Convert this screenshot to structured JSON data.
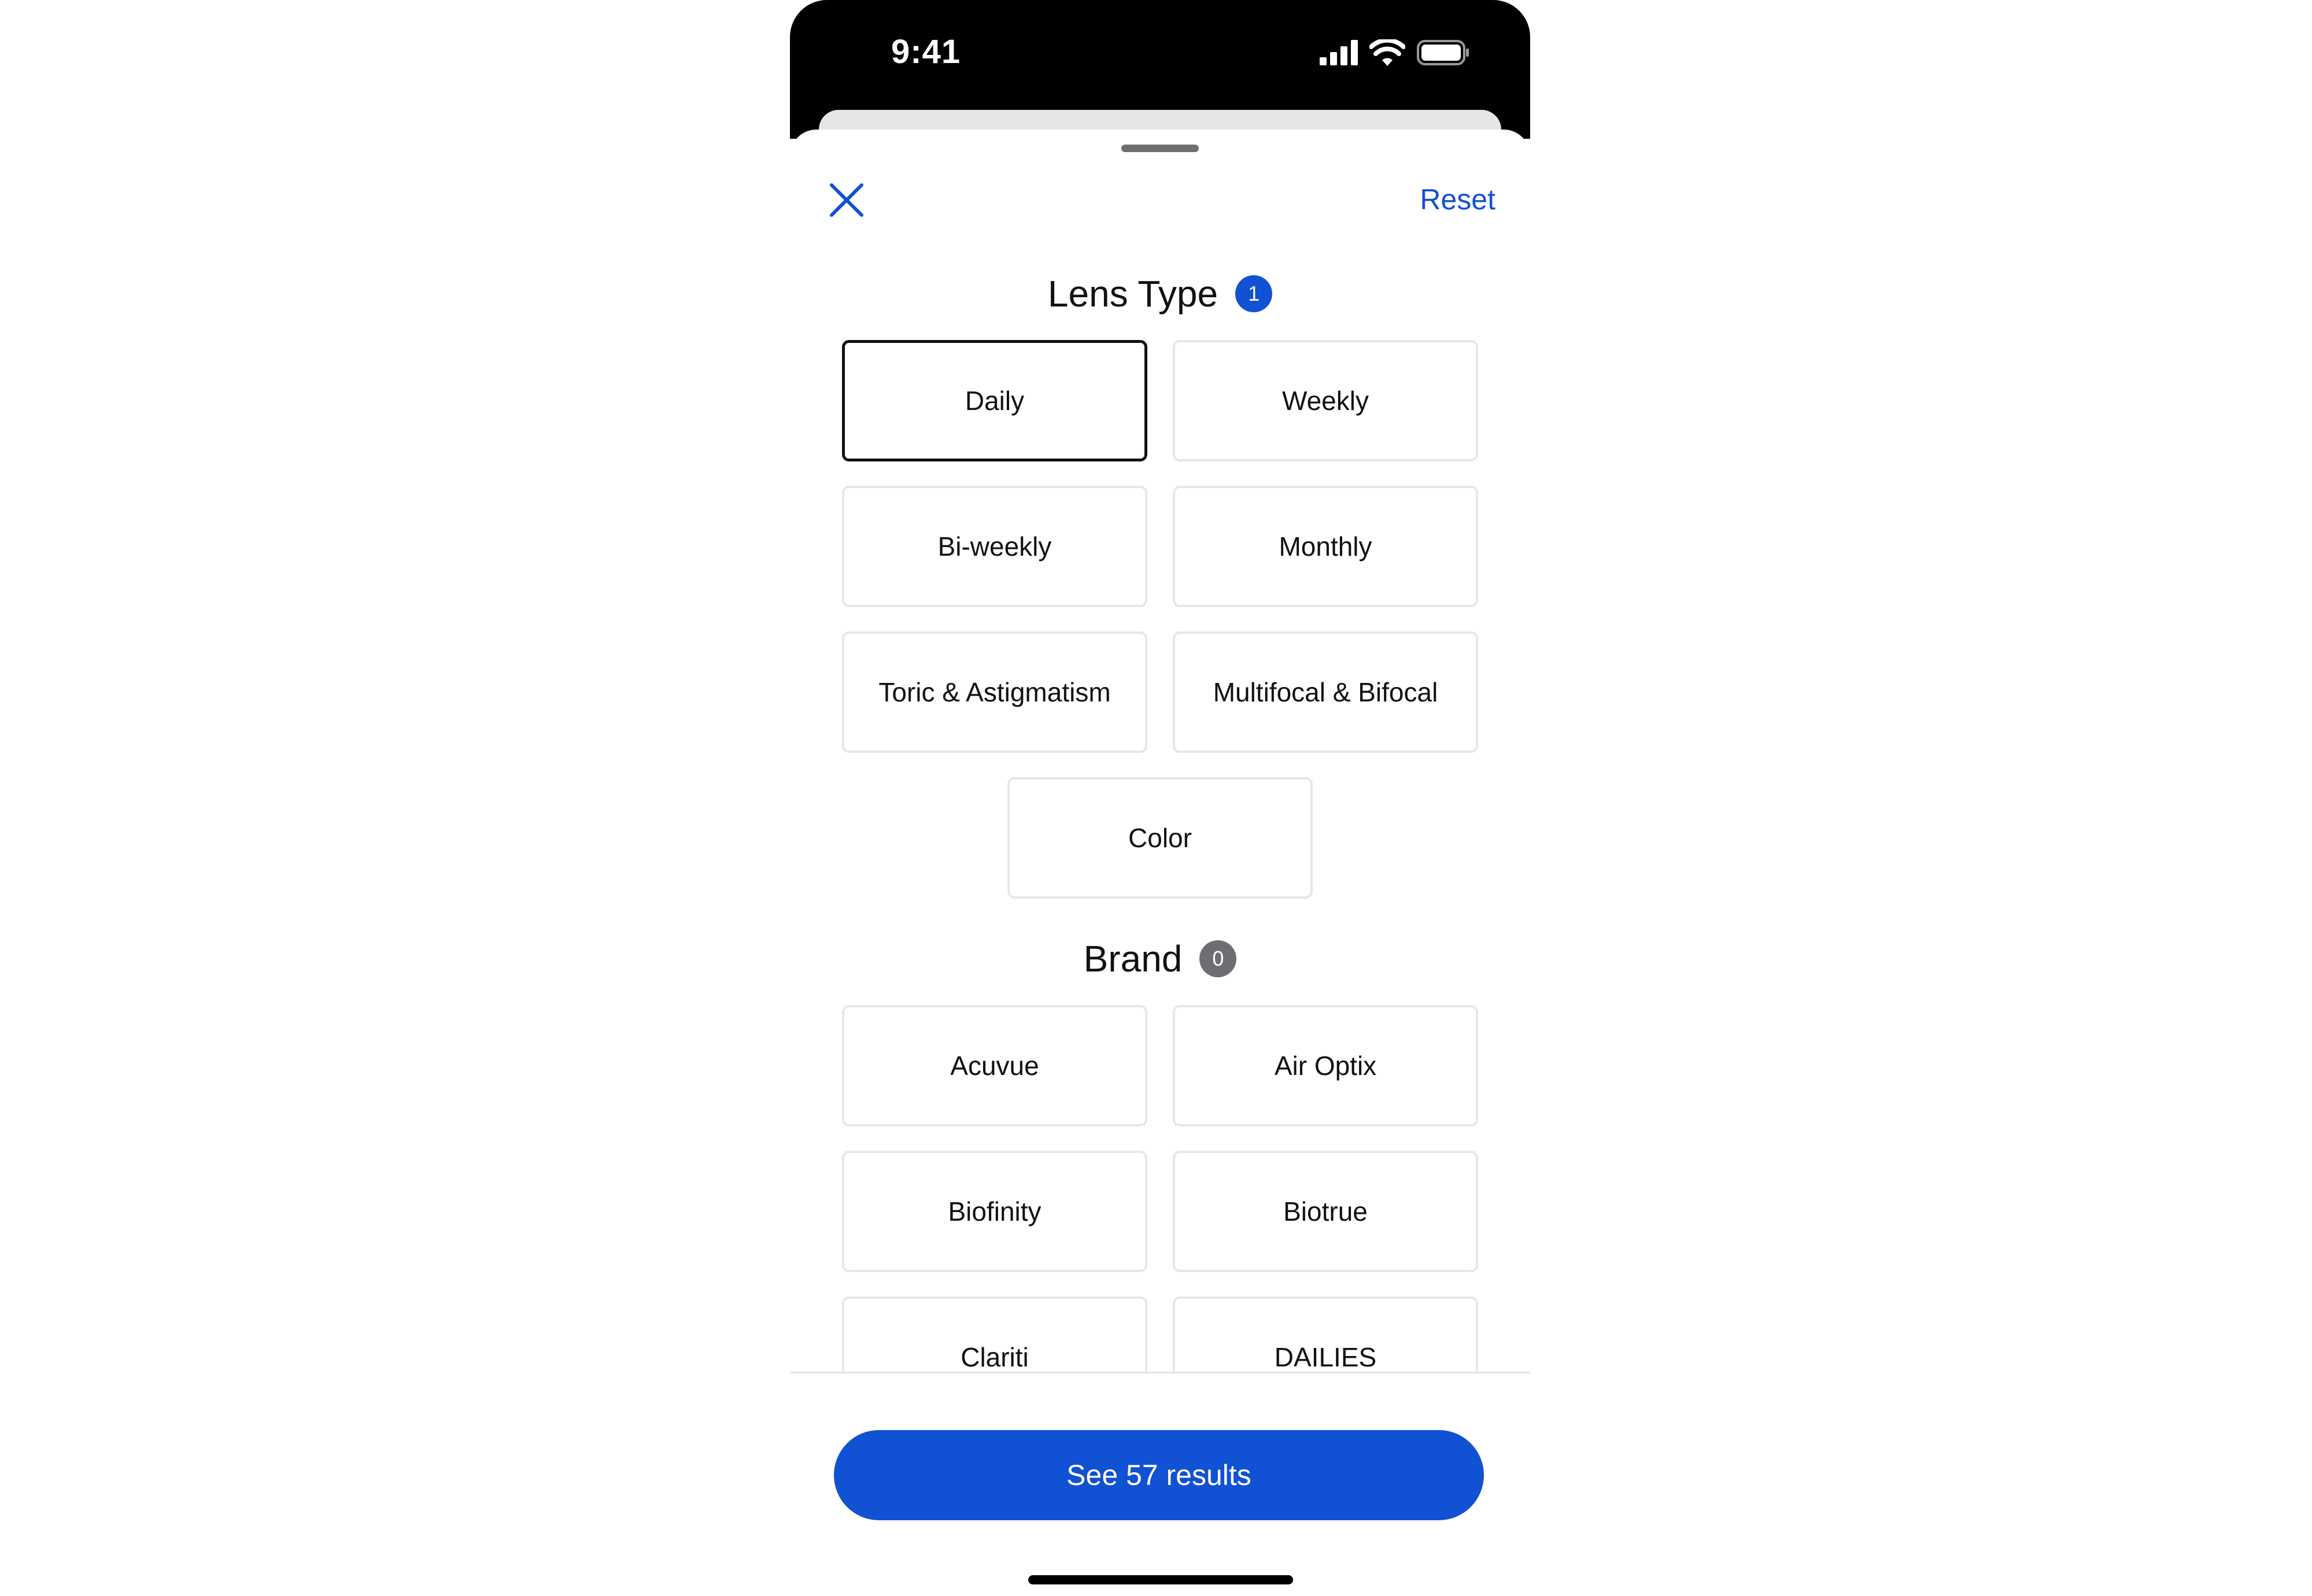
{
  "status_bar": {
    "time": "9:41"
  },
  "header": {
    "close_label": "Close",
    "reset_label": "Reset"
  },
  "lens_type": {
    "title": "Lens Type",
    "badge": "1",
    "options": [
      {
        "label": "Daily",
        "selected": true
      },
      {
        "label": "Weekly",
        "selected": false
      },
      {
        "label": "Bi-weekly",
        "selected": false
      },
      {
        "label": "Monthly",
        "selected": false
      },
      {
        "label": "Toric & Astigmatism",
        "selected": false
      },
      {
        "label": "Multifocal & Bifocal",
        "selected": false
      },
      {
        "label": "Color",
        "selected": false
      }
    ]
  },
  "brand": {
    "title": "Brand",
    "badge": "0",
    "options": [
      {
        "label": "Acuvue"
      },
      {
        "label": "Air Optix"
      },
      {
        "label": "Biofinity"
      },
      {
        "label": "Biotrue"
      },
      {
        "label": "Clariti"
      },
      {
        "label": "DAILIES"
      }
    ]
  },
  "footer": {
    "cta_label": "See 57 results"
  },
  "colors": {
    "accent": "#1151d3",
    "badge_gray": "#6d6e72",
    "border": "#e6e7ea",
    "selected_border": "#111111"
  },
  "icons": {
    "close": "close-icon",
    "signal": "cellular-signal-icon",
    "wifi": "wifi-icon",
    "battery": "battery-icon"
  }
}
